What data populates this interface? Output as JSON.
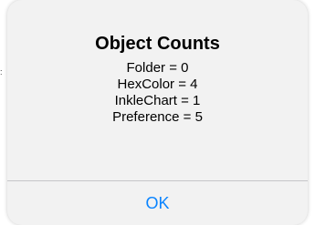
{
  "alert": {
    "title": "Object Counts",
    "lines": [
      "Folder = 0",
      "HexColor = 4",
      "InkleChart = 1",
      "Preference = 5"
    ],
    "ok_label": "OK"
  },
  "colors": {
    "accent": "#0a84ff",
    "alert_background": "#f2f2f2",
    "divider": "#c6c6c8"
  }
}
